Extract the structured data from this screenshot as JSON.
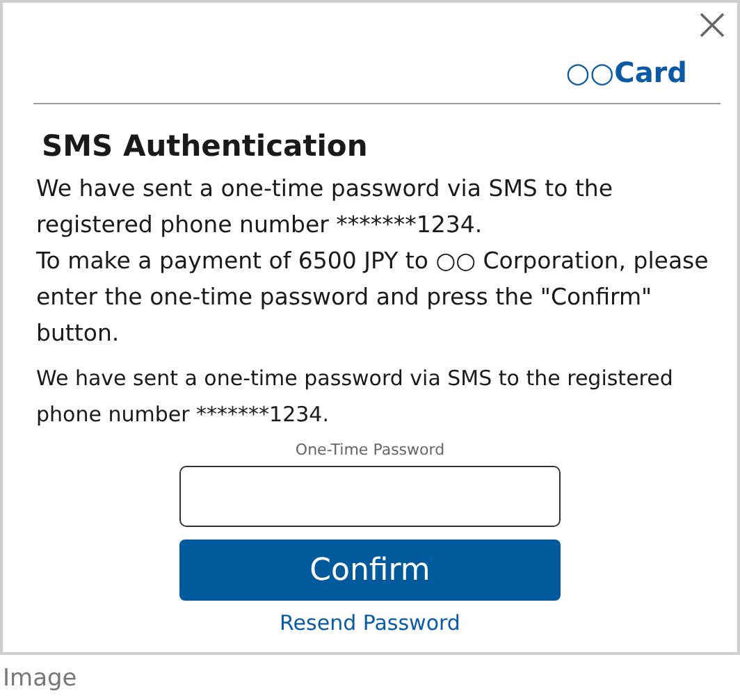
{
  "dialog": {
    "brand": "○○Card",
    "title": "SMS Authentication",
    "message": [
      "We have sent a one-time password via SMS to the registered phone number *******1234.",
      "To make a payment of 6500 JPY to ○○ Corporation, please enter the one-time password and press the \"Confirm\" button."
    ],
    "note": "We have sent a one-time password via SMS to the registered phone number *******1234.",
    "password_field": {
      "label": "One-Time Password"
    },
    "confirm_button": "Confirm",
    "resend_link": "Resend Password"
  },
  "caption": "Image"
}
